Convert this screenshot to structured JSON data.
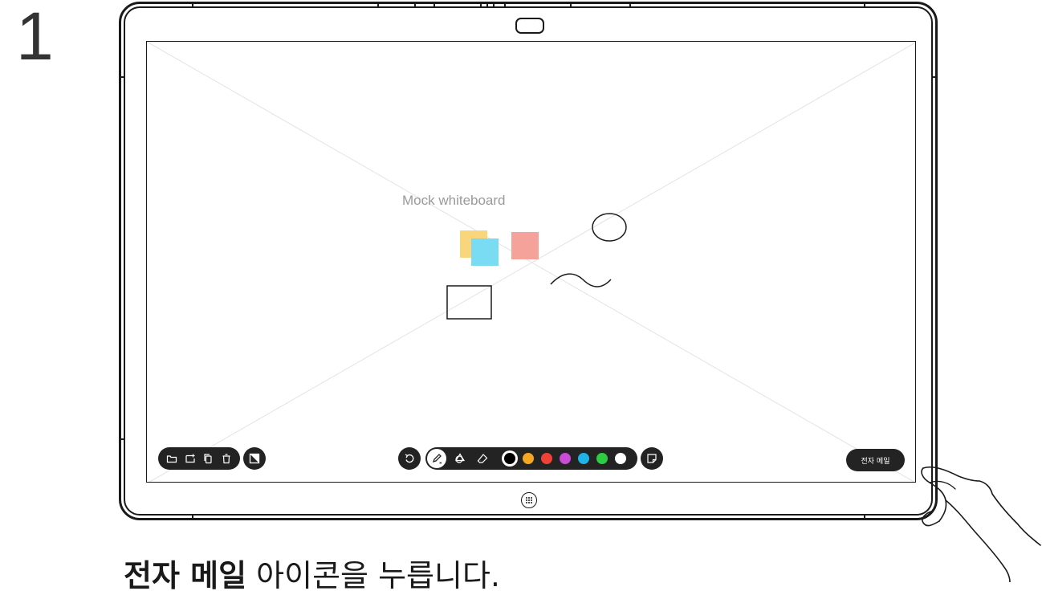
{
  "step": {
    "number": "1"
  },
  "whiteboard": {
    "label": "Mock whiteboard",
    "sticky_colors": [
      "#f9d67c",
      "#79dcf2",
      "#f5a29a"
    ]
  },
  "toolbar": {
    "left_tools": [
      "folder-icon",
      "add-page-icon",
      "copy-pages-icon",
      "trash-icon"
    ],
    "background_icon": "background-icon",
    "undo_icon": "undo-icon",
    "pen_icon": "pen-icon",
    "shapes_icon": "shapes-icon",
    "eraser_icon": "eraser-icon",
    "colors": [
      "#000000",
      "#f5a623",
      "#ef4136",
      "#c94bd6",
      "#1fb3e8",
      "#2ecc40",
      "#ffffff"
    ],
    "selected_color": "#000000",
    "sticky_note_icon": "sticky-note-icon",
    "email_label": "전자 메일"
  },
  "caption": {
    "bold": "전자 메일",
    "rest": " 아이콘을 누릅니다."
  }
}
